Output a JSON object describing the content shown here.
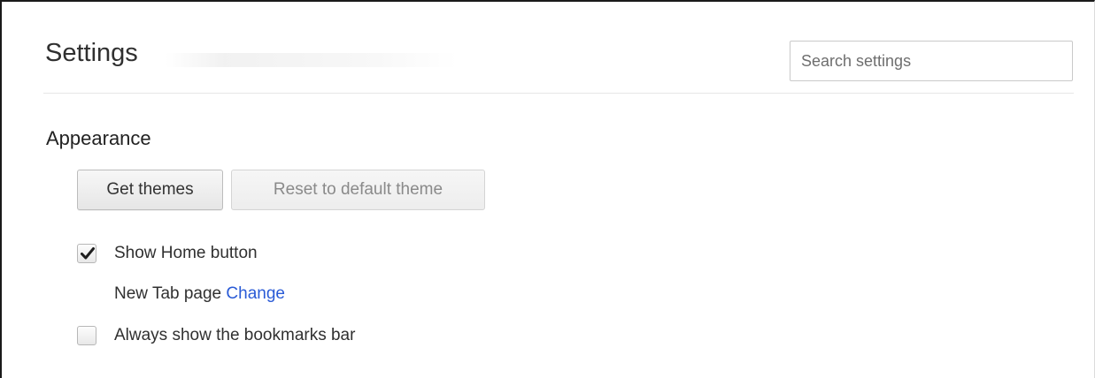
{
  "header": {
    "title": "Settings",
    "search": {
      "placeholder": "Search settings",
      "value": ""
    }
  },
  "appearance": {
    "section_title": "Appearance",
    "buttons": {
      "get_themes": "Get themes",
      "reset_theme": "Reset to default theme"
    },
    "show_home_button": {
      "label": "Show Home button",
      "checked": true
    },
    "home_page": {
      "text": "New Tab page",
      "link_label": "Change"
    },
    "bookmarks_bar": {
      "label": "Always show the bookmarks bar",
      "checked": false
    }
  },
  "colors": {
    "link": "#2a5bd6",
    "text": "#303030",
    "disabled_text": "#8a8a8a"
  },
  "icons": {
    "checkmark": "checkmark-icon"
  }
}
